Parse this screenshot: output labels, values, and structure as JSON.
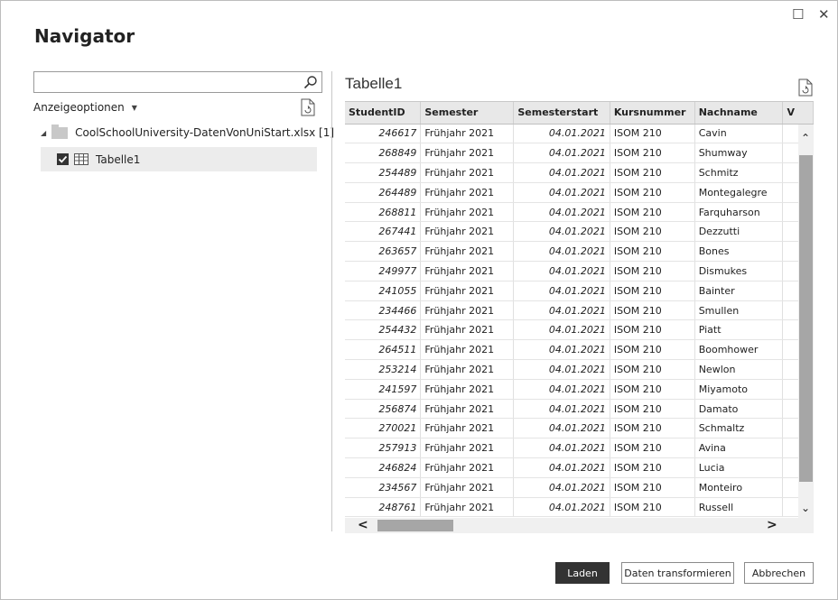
{
  "window": {
    "title": "Navigator",
    "maximize_glyph": "☐",
    "close_glyph": "✕"
  },
  "left_pane": {
    "search": {
      "value": "",
      "placeholder": ""
    },
    "display_options_label": "Anzeigeoptionen",
    "tree": {
      "file_label": "CoolSchoolUniversity-DatenVonUniStart.xlsx [1]",
      "items": [
        {
          "label": "Tabelle1",
          "checked": true,
          "selected": true
        }
      ]
    }
  },
  "preview": {
    "title": "Tabelle1",
    "columns": [
      "StudentID",
      "Semester",
      "Semesterstart",
      "Kursnummer",
      "Nachname",
      "V"
    ],
    "rows": [
      [
        "246617",
        "Frühjahr 2021",
        "04.01.2021",
        "ISOM 210",
        "Cavin"
      ],
      [
        "268849",
        "Frühjahr 2021",
        "04.01.2021",
        "ISOM 210",
        "Shumway"
      ],
      [
        "254489",
        "Frühjahr 2021",
        "04.01.2021",
        "ISOM 210",
        "Schmitz"
      ],
      [
        "264489",
        "Frühjahr 2021",
        "04.01.2021",
        "ISOM 210",
        "Montegalegre"
      ],
      [
        "268811",
        "Frühjahr 2021",
        "04.01.2021",
        "ISOM 210",
        "Farquharson"
      ],
      [
        "267441",
        "Frühjahr 2021",
        "04.01.2021",
        "ISOM 210",
        "Dezzutti"
      ],
      [
        "263657",
        "Frühjahr 2021",
        "04.01.2021",
        "ISOM 210",
        "Bones"
      ],
      [
        "249977",
        "Frühjahr 2021",
        "04.01.2021",
        "ISOM 210",
        "Dismukes"
      ],
      [
        "241055",
        "Frühjahr 2021",
        "04.01.2021",
        "ISOM 210",
        "Bainter"
      ],
      [
        "234466",
        "Frühjahr 2021",
        "04.01.2021",
        "ISOM 210",
        "Smullen"
      ],
      [
        "254432",
        "Frühjahr 2021",
        "04.01.2021",
        "ISOM 210",
        "Piatt"
      ],
      [
        "264511",
        "Frühjahr 2021",
        "04.01.2021",
        "ISOM 210",
        "Boomhower"
      ],
      [
        "253214",
        "Frühjahr 2021",
        "04.01.2021",
        "ISOM 210",
        "Newlon"
      ],
      [
        "241597",
        "Frühjahr 2021",
        "04.01.2021",
        "ISOM 210",
        "Miyamoto"
      ],
      [
        "256874",
        "Frühjahr 2021",
        "04.01.2021",
        "ISOM 210",
        "Damato"
      ],
      [
        "270021",
        "Frühjahr 2021",
        "04.01.2021",
        "ISOM 210",
        "Schmaltz"
      ],
      [
        "257913",
        "Frühjahr 2021",
        "04.01.2021",
        "ISOM 210",
        "Avina"
      ],
      [
        "246824",
        "Frühjahr 2021",
        "04.01.2021",
        "ISOM 210",
        "Lucia"
      ],
      [
        "234567",
        "Frühjahr 2021",
        "04.01.2021",
        "ISOM 210",
        "Monteiro"
      ],
      [
        "248761",
        "Frühjahr 2021",
        "04.01.2021",
        "ISOM 210",
        "Russell"
      ]
    ]
  },
  "footer": {
    "load_label": "Laden",
    "transform_label": "Daten transformieren",
    "cancel_label": "Abbrechen"
  },
  "icons": {
    "search": "search-icon",
    "refresh": "refresh-icon",
    "folder": "folder-icon",
    "table": "table-icon",
    "checkbox": "checkbox-checked-icon"
  },
  "colors": {
    "primary_button": "#333333",
    "scrollbar_thumb": "#a6a6a6",
    "selected_row": "#ececec",
    "header_bg": "#e8e8e8"
  }
}
